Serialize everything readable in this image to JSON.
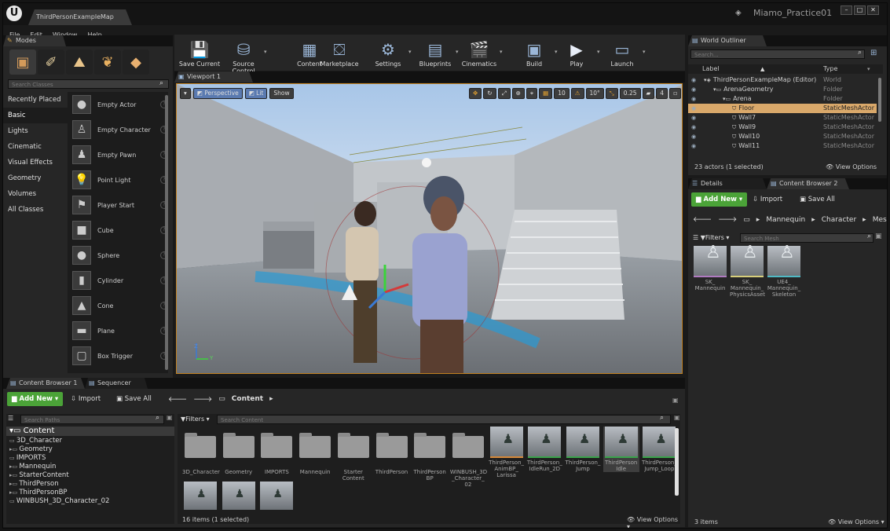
{
  "window": {
    "doc_tab": "ThirdPersonExampleMap",
    "project": "Miamo_Practice01"
  },
  "menu": [
    "File",
    "Edit",
    "Window",
    "Help"
  ],
  "modes": {
    "tab": "Modes",
    "search_placeholder": "Search Classes",
    "categories": [
      "Recently Placed",
      "Basic",
      "Lights",
      "Cinematic",
      "Visual Effects",
      "Geometry",
      "Volumes",
      "All Classes"
    ],
    "selected_category": "Basic",
    "items": [
      {
        "label": "Empty Actor",
        "icon": "sphere-icon"
      },
      {
        "label": "Empty Character",
        "icon": "mannequin-icon"
      },
      {
        "label": "Empty Pawn",
        "icon": "pawn-icon"
      },
      {
        "label": "Point Light",
        "icon": "bulb-icon"
      },
      {
        "label": "Player Start",
        "icon": "player-start-icon"
      },
      {
        "label": "Cube",
        "icon": "cube-icon"
      },
      {
        "label": "Sphere",
        "icon": "sphere-icon"
      },
      {
        "label": "Cylinder",
        "icon": "cylinder-icon"
      },
      {
        "label": "Cone",
        "icon": "cone-icon"
      },
      {
        "label": "Plane",
        "icon": "plane-icon"
      },
      {
        "label": "Box Trigger",
        "icon": "box-trigger-icon"
      }
    ]
  },
  "toolbar": [
    {
      "label": "Save Current",
      "icon": "save-icon",
      "dropdown": false
    },
    {
      "label": "Source Control",
      "icon": "source-control-icon",
      "dropdown": true
    },
    {
      "label": "Content",
      "icon": "content-icon",
      "dropdown": false
    },
    {
      "label": "Marketplace",
      "icon": "marketplace-icon",
      "dropdown": false
    },
    {
      "label": "Settings",
      "icon": "gear-icon",
      "dropdown": true
    },
    {
      "label": "Blueprints",
      "icon": "blueprint-icon",
      "dropdown": true
    },
    {
      "label": "Cinematics",
      "icon": "clapper-icon",
      "dropdown": true
    },
    {
      "label": "Build",
      "icon": "build-icon",
      "dropdown": true
    },
    {
      "label": "Play",
      "icon": "play-icon",
      "dropdown": true
    },
    {
      "label": "Launch",
      "icon": "launch-icon",
      "dropdown": true
    }
  ],
  "viewport": {
    "tab": "Viewport 1",
    "perspective": "Perspective",
    "lit": "Lit",
    "show": "Show",
    "grid_snap": "10",
    "rot_snap": "10°",
    "scale_snap": "0.25",
    "cam_speed": "4",
    "axis_z": "Z",
    "axis_y": "Y"
  },
  "outliner": {
    "tab": "World Outliner",
    "search_placeholder": "Search...",
    "col_label": "Label",
    "col_type": "Type",
    "rows": [
      {
        "indent": 0,
        "label": "ThirdPersonExampleMap (Editor)",
        "type": "World",
        "selected": false
      },
      {
        "indent": 1,
        "label": "ArenaGeometry",
        "type": "Folder",
        "selected": false
      },
      {
        "indent": 2,
        "label": "Arena",
        "type": "Folder",
        "selected": false
      },
      {
        "indent": 3,
        "label": "Floor",
        "type": "StaticMeshActor",
        "selected": true
      },
      {
        "indent": 3,
        "label": "Wall7",
        "type": "StaticMeshActor",
        "selected": false
      },
      {
        "indent": 3,
        "label": "Wall9",
        "type": "StaticMeshActor",
        "selected": false
      },
      {
        "indent": 3,
        "label": "Wall10",
        "type": "StaticMeshActor",
        "selected": false
      },
      {
        "indent": 3,
        "label": "Wall11",
        "type": "StaticMeshActor",
        "selected": false
      }
    ],
    "status": "23 actors (1 selected)",
    "view_options": "View Options"
  },
  "right_browser": {
    "tab_details": "Details",
    "tab_cb": "Content Browser 2",
    "add_new": "Add New",
    "import": "Import",
    "save_all": "Save All",
    "path": [
      "Mannequin",
      "Character",
      "Mesh"
    ],
    "filters": "Filters",
    "search_placeholder": "Search Mesh",
    "assets": [
      {
        "label": "SK_ Mannequin",
        "color": "#b07ac0"
      },
      {
        "label": "SK_ Mannequin_ PhysicsAsset",
        "color": "#d7ce7a"
      },
      {
        "label": "UE4_ Mannequin_ Skeleton",
        "color": "#4fb9c4"
      }
    ],
    "count": "3 items",
    "view_options": "View Options"
  },
  "bottom": {
    "tab_cb": "Content Browser 1",
    "tab_seq": "Sequencer",
    "add_new": "Add New",
    "import": "Import",
    "save_all": "Save All",
    "path": "Content",
    "search_paths": "Search Paths",
    "filters": "Filters",
    "search_content": "Search Content",
    "tree_root": "Content",
    "tree": [
      "3D_Character",
      "Geometry",
      "IMPORTS",
      "Mannequin",
      "StarterContent",
      "ThirdPerson",
      "ThirdPersonBP",
      "WINBUSH_3D_Character_02"
    ],
    "folders": [
      "3D_Character",
      "Geometry",
      "IMPORTS",
      "Mannequin",
      "Starter Content",
      "ThirdPerson",
      "ThirdPerson BP",
      "WINBUSH_3D _Character_ 02"
    ],
    "assets": [
      {
        "label": "ThirdPerson_ AnimBP_ Larissa",
        "color": "#d68a3a"
      },
      {
        "label": "ThirdPerson_ IdleRun_2D",
        "color": "#3aa34a"
      },
      {
        "label": "ThirdPerson_ Jump",
        "color": "#3aa34a"
      },
      {
        "label": "ThirdPerson Idle",
        "color": "#3aa34a"
      },
      {
        "label": "ThirdPerson_ Jump_Loop",
        "color": "#3aa34a"
      }
    ],
    "status": "16 items (1 selected)",
    "view_options": "View Options"
  }
}
